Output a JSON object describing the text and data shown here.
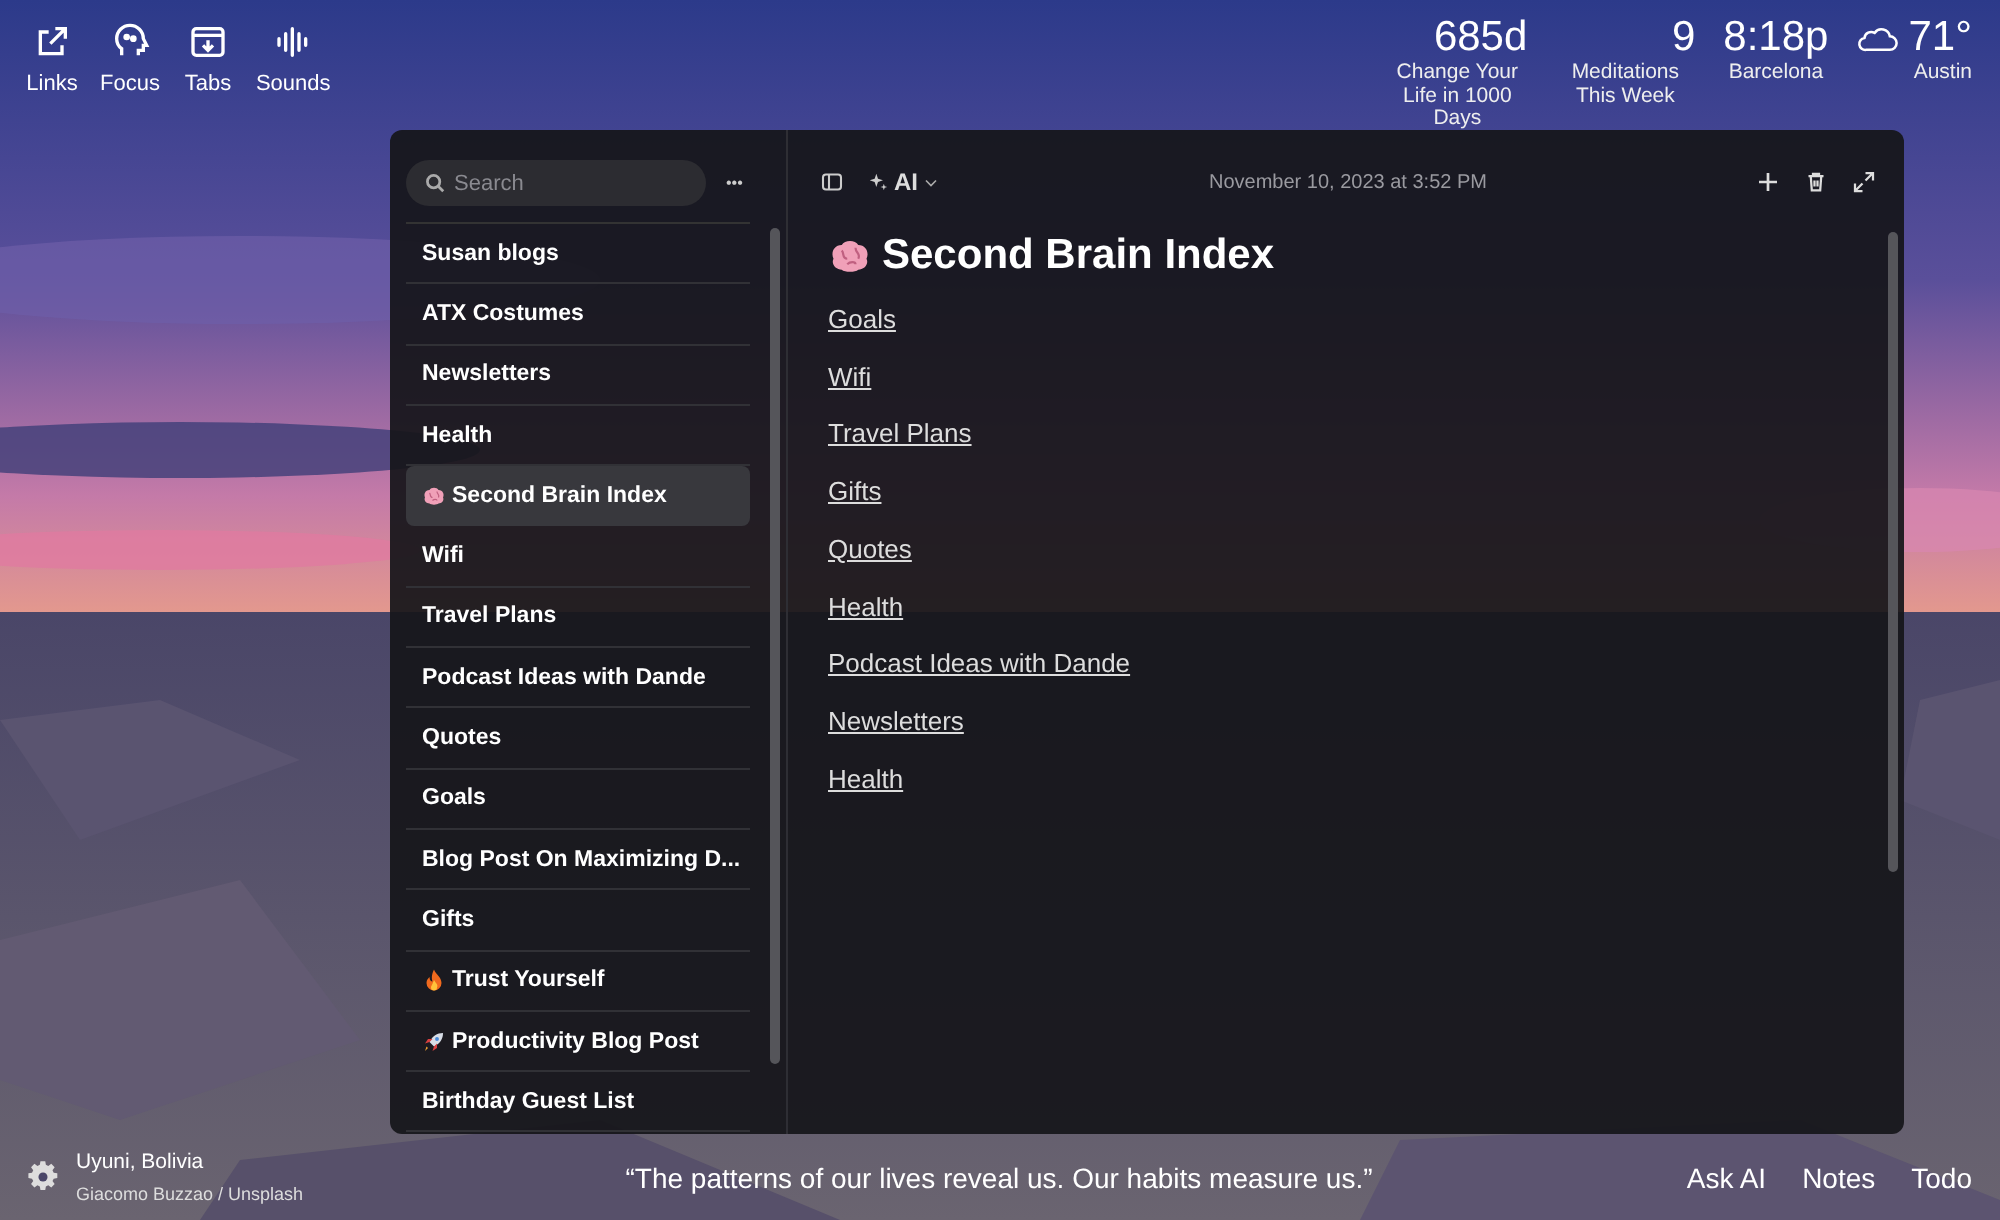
{
  "top_left_shortcuts": [
    {
      "kind": "links",
      "label": "Links"
    },
    {
      "kind": "focus",
      "label": "Focus"
    },
    {
      "kind": "tabs",
      "label": "Tabs"
    },
    {
      "kind": "sounds",
      "label": "Sounds"
    }
  ],
  "top_right_widgets": [
    {
      "kind": "metric",
      "value": "685d",
      "label": "Change Your Life in 1000 Days"
    },
    {
      "kind": "metric",
      "value": "9",
      "label": "Meditations This Week"
    },
    {
      "kind": "clock",
      "value": "8:18p",
      "label": "Barcelona"
    },
    {
      "kind": "weather",
      "value": "71°",
      "label": "Austin"
    }
  ],
  "notes_sidebar": {
    "search": {
      "placeholder": "Search"
    },
    "more": "•••",
    "items": [
      {
        "title": "Susan blogs",
        "selected": false
      },
      {
        "title": "ATX Costumes",
        "selected": false
      },
      {
        "title": "Newsletters",
        "selected": false
      },
      {
        "title": "Health",
        "selected": false
      },
      {
        "title": "Second Brain Index",
        "kind": "brain",
        "selected": true
      },
      {
        "title": "Wifi",
        "selected": false
      },
      {
        "title": "Travel Plans",
        "selected": false
      },
      {
        "title": "Podcast Ideas with Dande",
        "selected": false
      },
      {
        "title": "Quotes",
        "selected": false
      },
      {
        "title": "Goals",
        "selected": false
      },
      {
        "title": "Blog Post On Maximizing D...",
        "selected": false
      },
      {
        "title": "Gifts",
        "selected": false
      },
      {
        "title": "Trust Yourself",
        "kind": "fire",
        "selected": false
      },
      {
        "title": "Productivity Blog Post",
        "kind": "rocket",
        "selected": false
      },
      {
        "title": "Birthday Guest List",
        "selected": false
      }
    ]
  },
  "note": {
    "ai_label": "AI",
    "timestamp": "November 10, 2023 at 3:52 PM",
    "title": {
      "kind": "brain",
      "text": "Second Brain Index"
    },
    "links": [
      "Goals",
      "Wifi",
      "Travel Plans",
      "Gifts",
      "Quotes",
      "Health",
      "Podcast Ideas with Dande",
      "Newsletters",
      "Health"
    ]
  },
  "footer": {
    "location": "Uyuni, Bolivia",
    "credit": "Giacomo Buzzao / Unsplash",
    "quote": "“The patterns of our lives reveal us. Our habits measure us.”",
    "buttons": [
      "Ask AI",
      "Notes",
      "Todo"
    ]
  }
}
